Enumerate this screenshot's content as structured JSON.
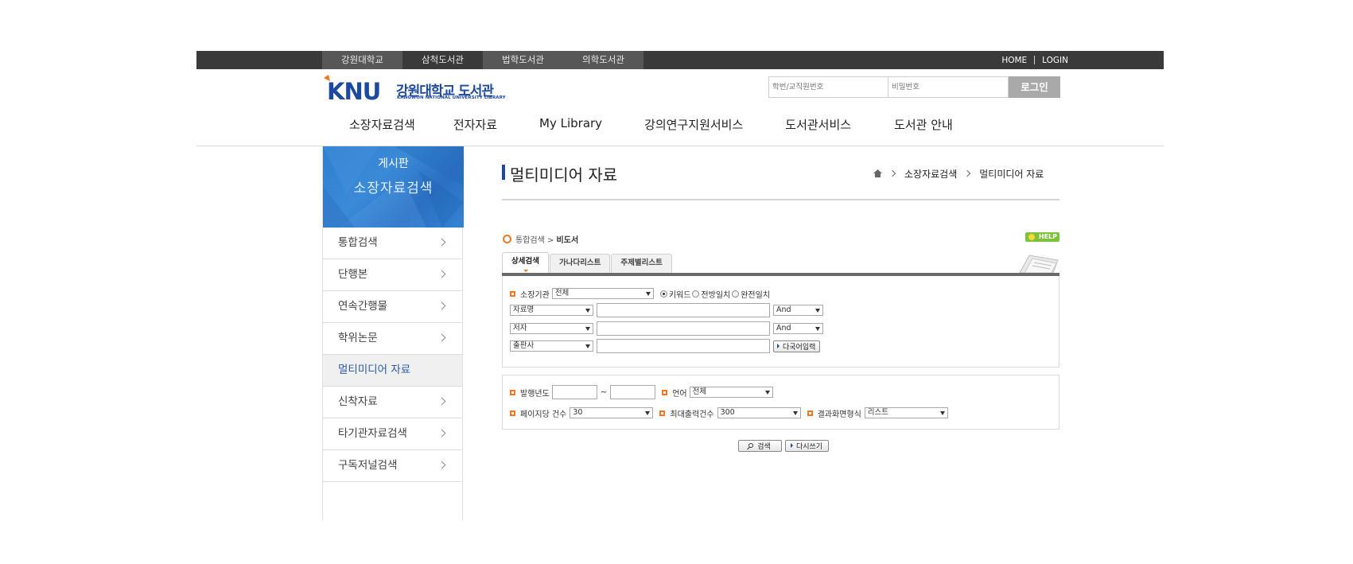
{
  "site_tabs": [
    "강원대학교",
    "삼척도서관",
    "법학도서관",
    "의학도서관"
  ],
  "util": {
    "home": "HOME",
    "login": "LOGIN"
  },
  "logo": {
    "mark": "KNU",
    "name": "강원대학교 도서관",
    "sub": "KANGWON NATIONAL UNIVERSITY LIBRARY",
    "accent": "#f07820",
    "brand": "#1d4aa0"
  },
  "login": {
    "id_placeholder": "학번/교직원번호",
    "pw_placeholder": "비밀번호",
    "button": "로그인"
  },
  "gnb": [
    "소장자료검색",
    "전자자료",
    "My Library",
    "강의연구지원서비스",
    "도서관서비스",
    "도서관 안내"
  ],
  "lnb": {
    "title": "게시판",
    "subtitle": "소장자료검색",
    "items": [
      "통합검색",
      "단행본",
      "연속간행물",
      "학위논문",
      "멀티미디어 자료",
      "신착자료",
      "타기관자료검색",
      "구독저널검색"
    ],
    "active_index": 4
  },
  "page": {
    "title": "멀티미디어 자료",
    "breadcrumb": [
      "소장자료검색",
      "멀티미디어 자료"
    ]
  },
  "search": {
    "crumb": {
      "parent": "통합검색 >",
      "current": "비도서"
    },
    "help": "HELP",
    "tabs": [
      "상세검색",
      "가나다리스트",
      "주제별리스트"
    ],
    "holding_label": "소장기관",
    "holding_value": "전체",
    "match_options": [
      "키워드",
      "전방일치",
      "완전일치"
    ],
    "match_selected": 0,
    "fields": [
      {
        "field": "자료명",
        "op": "And"
      },
      {
        "field": "저자",
        "op": "And"
      },
      {
        "field": "출판사",
        "op": ""
      }
    ],
    "multilang_button": "다국어입력",
    "year_label": "발행년도",
    "year_sep": "~",
    "lang_label": "언어",
    "lang_value": "전체",
    "per_page_label": "페이지당 건수",
    "per_page_value": "30",
    "max_label": "최대출력건수",
    "max_value": "300",
    "format_label": "결과화면형식",
    "format_value": "리스트",
    "search_button": "검색",
    "reset_button": "다시쓰기"
  }
}
